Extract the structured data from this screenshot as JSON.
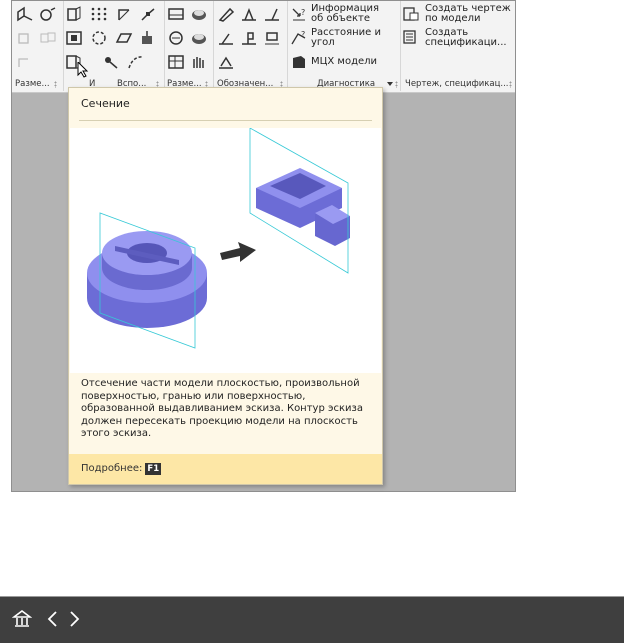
{
  "ribbon": {
    "group_labels": [
      "Разме...",
      "И",
      "Вспо...",
      "Разме...",
      "Обозначен...",
      "Диагностика",
      "Чертеж, спецификац..."
    ],
    "commands": {
      "object_info": "Информация\nоб объекте",
      "distance_angle": "Расстояние и\nугол",
      "mcx_model": "МЦХ модели",
      "create_drawing": "Создать чертеж\nпо модели",
      "create_spec": "Создать\nспецификаци..."
    }
  },
  "tooltip": {
    "title": "Сечение",
    "description": "Отсечение части модели плоскостью, произвольной поверхностью, гранью или поверхностью, образованной выдавливанием эскиза. Контур эскиза должен пересекать проекцию модели на плоскость этого эскиза.",
    "more_label": "Подробнее:",
    "hotkey": "F1"
  },
  "colors": {
    "tooltip_bg": "#fef8e7",
    "tooltip_footer": "#fde7a6",
    "model_fill": "#8585e6",
    "plane_stroke": "#37c9d6",
    "bottom_bar": "#3f3f3f"
  },
  "bottom_bar": {
    "icons": [
      "home-icon",
      "chevron-left-icon",
      "chevron-right-icon"
    ]
  }
}
